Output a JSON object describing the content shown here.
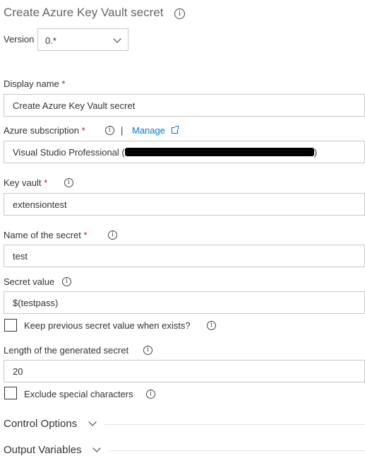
{
  "title": "Create Azure Key Vault secret",
  "version": {
    "label": "Version",
    "value": "0.*"
  },
  "display_name": {
    "label": "Display name",
    "required_mark": "*",
    "value": "Create Azure Key Vault secret"
  },
  "subscription": {
    "label": "Azure subscription",
    "required_mark": "*",
    "link_label": "Manage",
    "separator": "|",
    "value_prefix": "Visual Studio Professional (",
    "value_suffix": ")"
  },
  "key_vault": {
    "label": "Key vault",
    "required_mark": "*",
    "value": "extensiontest"
  },
  "secret_name": {
    "label": "Name of the secret",
    "required_mark": "*",
    "value": "test"
  },
  "secret_value": {
    "label": "Secret value",
    "value": "$(testpass)"
  },
  "keep_previous": {
    "label": "Keep previous secret value when exists?",
    "checked": false
  },
  "length": {
    "label": "Length of the generated secret",
    "value": "20"
  },
  "exclude_special": {
    "label": "Exclude special characters",
    "checked": false
  },
  "sections": {
    "control_options": "Control Options",
    "output_variables": "Output Variables"
  },
  "colors": {
    "accent": "#0078d4",
    "required": "#a4262c",
    "border": "#c8c8c8"
  },
  "icons": {
    "info": "info-icon",
    "external": "external-link-icon",
    "chevron": "chevron-down-icon"
  }
}
